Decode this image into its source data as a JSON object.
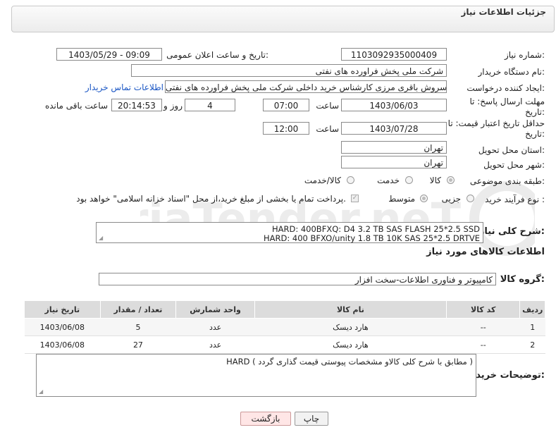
{
  "header": {
    "title": "جزئیات اطلاعات نیاز"
  },
  "form": {
    "need_number_label": "شماره نیاز:",
    "need_number": "1103092935000409",
    "announce_label": "تاریخ و ساعت اعلان عمومی:",
    "announce_value": "1403/05/29 - 09:09",
    "buyer_org_label": "نام دستگاه خریدار:",
    "buyer_org": "شرکت ملی پخش فراورده های نفتی",
    "creator_label": "ایجاد کننده درخواست:",
    "creator": "سروش باقری مرزی کارشناس خرید داخلی شرکت ملی پخش فراورده های نفتی",
    "contact_link": "اطلاعات تماس خریدار",
    "deadline_label": "مهلت ارسال پاسخ: تا تاریخ:",
    "deadline_date": "1403/06/03",
    "time_label": "ساعت",
    "deadline_time": "07:00",
    "days_value": "4",
    "days_label": "روز و",
    "remaining_time": "20:14:53",
    "remaining_label": "ساعت باقی مانده",
    "price_label": "حداقل تاریخ اعتبار قیمت: تا تاریخ:",
    "price_date": "1403/07/28",
    "price_time": "12:00",
    "province_label": "استان محل تحویل:",
    "province": "تهران",
    "city_label": "شهر محل تحویل:",
    "city": "تهران",
    "category_label": "طبقه بندی موضوعی:",
    "category_options": [
      "کالا",
      "خدمت",
      "کالا/خدمت"
    ],
    "process_label": "نوع فرآیند خرید :",
    "process_options": [
      "جزیی",
      "متوسط"
    ],
    "payment_note": "پرداخت تمام یا بخشی از مبلغ خرید،از محل \"اسناد خزانه اسلامی\" خواهد بود."
  },
  "description": {
    "label": "شرح کلی نیاز:",
    "line1": "HARD: 400BFXQ: D4 3.2 TB SAS FLASH 25*2.5 SSD",
    "line2": "HARD: 400 BFXO/unity 1.8 TB 10K SAS 25*2.5 DRTVE"
  },
  "goods": {
    "section_title": "اطلاعات کالاهای مورد نیاز",
    "group_label": "گروه کالا:",
    "group_value": "کامپیوتر و فناوری اطلاعات-سخت افزار",
    "columns": [
      "ردیف",
      "کد کالا",
      "نام کالا",
      "واحد شمارش",
      "تعداد / مقدار",
      "تاریخ نیاز"
    ],
    "rows": [
      {
        "idx": "1",
        "code": "--",
        "name": "هارد دیسک",
        "unit": "عدد",
        "qty": "5",
        "date": "1403/06/08"
      },
      {
        "idx": "2",
        "code": "--",
        "name": "هارد دیسک",
        "unit": "عدد",
        "qty": "27",
        "date": "1403/06/08"
      }
    ]
  },
  "buyer_notes": {
    "label": "توضیحات خریدار:",
    "text": "HARD ( مطابق با شرح کلی کالاو مشخصات پیوستی قیمت گذاری گردد )"
  },
  "buttons": {
    "print": "چاپ",
    "back": "بازگشت"
  },
  "watermark": {
    "text": "AriaTender.neT"
  },
  "colors": {
    "link": "#1a56c4",
    "back_button_bg": "#ffe6e6",
    "print_button_bg": "#f2f2f2",
    "watermark": "#e7e7e7"
  }
}
